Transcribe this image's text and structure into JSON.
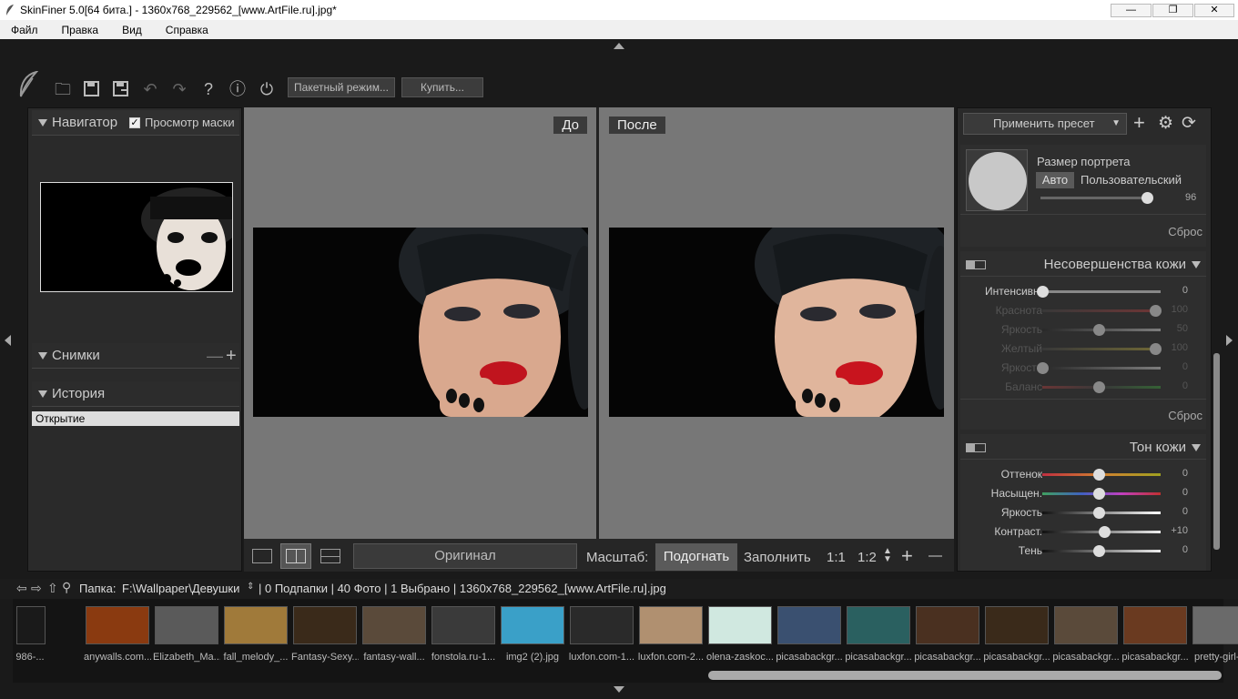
{
  "window": {
    "title": "SkinFiner 5.0[64 бита.] - 1360x768_229562_[www.ArtFile.ru].jpg*",
    "min": "—",
    "max": "❐",
    "close": "✕"
  },
  "menu": [
    "Файл",
    "Правка",
    "Вид",
    "Справка"
  ],
  "toolbar": {
    "batch_label": "Пакетный режим...",
    "buy_label": "Купить..."
  },
  "navigator": {
    "title": "Навигатор",
    "mask_label": "Просмотр маски",
    "mask_checked": true
  },
  "snapshots": {
    "title": "Снимки"
  },
  "history": {
    "title": "История",
    "items": [
      "Открытие"
    ]
  },
  "viewer": {
    "before_label": "До",
    "after_label": "После"
  },
  "viewbar": {
    "original_label": "Оригинал",
    "scale_label": "Масштаб:",
    "fit_label": "Подогнать",
    "fill_label": "Заполнить",
    "one_to_one": "1:1",
    "one_to_two": "1:2",
    "plus": "+",
    "minus": "—"
  },
  "right": {
    "preset_label": "Применить пресет",
    "portrait_size_label": "Размер портрета",
    "auto_label": "Авто",
    "custom_label": "Пользовательский",
    "portrait_value": "96",
    "portrait_fraction": 0.96,
    "reset_label": "Сброс",
    "skin_section_title": "Несовершенства кожи",
    "skin_sliders": [
      {
        "label": "Интенсивн.",
        "value": "0",
        "pos": 0.0,
        "dim": false
      },
      {
        "label": "Краснота",
        "value": "100",
        "pos": 1.0,
        "dim": true
      },
      {
        "label": "Яркость",
        "value": "50",
        "pos": 0.5,
        "dim": true
      },
      {
        "label": "Желтый",
        "value": "100",
        "pos": 1.0,
        "dim": true
      },
      {
        "label": "Яркость",
        "value": "0",
        "pos": 0.0,
        "dim": true
      },
      {
        "label": "Баланс",
        "value": "0",
        "pos": 0.5,
        "dim": true
      }
    ],
    "tone_section_title": "Тон кожи",
    "tone_sliders": [
      {
        "label": "Оттенок",
        "value": "0",
        "pos": 0.5,
        "dim": false
      },
      {
        "label": "Насыщен.",
        "value": "0",
        "pos": 0.5,
        "dim": false
      },
      {
        "label": "Яркость",
        "value": "0",
        "pos": 0.5,
        "dim": false
      },
      {
        "label": "Контраст.",
        "value": "+10",
        "pos": 0.55,
        "dim": false
      },
      {
        "label": "Тень",
        "value": "0",
        "pos": 0.5,
        "dim": false
      }
    ]
  },
  "pathbar": {
    "folder_label": "Папка:",
    "path": "F:\\Wallpaper\\Девушки",
    "info": "| 0 Подпапки | 40 Фото | 1 Выбрано | 1360x768_229562_[www.ArtFile.ru].jpg"
  },
  "filmstrip": [
    {
      "label": "986-...",
      "color": "#1a1a1a"
    },
    {
      "label": "anywalls.com...",
      "color": "#8a3a10"
    },
    {
      "label": "Elizabeth_Ma...",
      "color": "#5a5a5a"
    },
    {
      "label": "fall_melody_...",
      "color": "#a07a3a"
    },
    {
      "label": "Fantasy-Sexy...",
      "color": "#3a2a1a"
    },
    {
      "label": "fantasy-wall...",
      "color": "#5a4a3a"
    },
    {
      "label": "fonstola.ru-1...",
      "color": "#3a3a3a"
    },
    {
      "label": "img2 (2).jpg",
      "color": "#3aa0c8"
    },
    {
      "label": "luxfon.com-1...",
      "color": "#2a2a2a"
    },
    {
      "label": "luxfon.com-2...",
      "color": "#b09070"
    },
    {
      "label": "olena-zaskoc...",
      "color": "#d0e8e0"
    },
    {
      "label": "picasabackgr...",
      "color": "#3a5070"
    },
    {
      "label": "picasabackgr...",
      "color": "#2a6060"
    },
    {
      "label": "picasabackgr...",
      "color": "#4a3020"
    },
    {
      "label": "picasabackgr...",
      "color": "#3a2a1a"
    },
    {
      "label": "picasabackgr...",
      "color": "#5a4a3a"
    },
    {
      "label": "picasabackgr...",
      "color": "#6a3a20"
    },
    {
      "label": "pretty-girl-w...",
      "color": "#6a6a6a"
    }
  ]
}
